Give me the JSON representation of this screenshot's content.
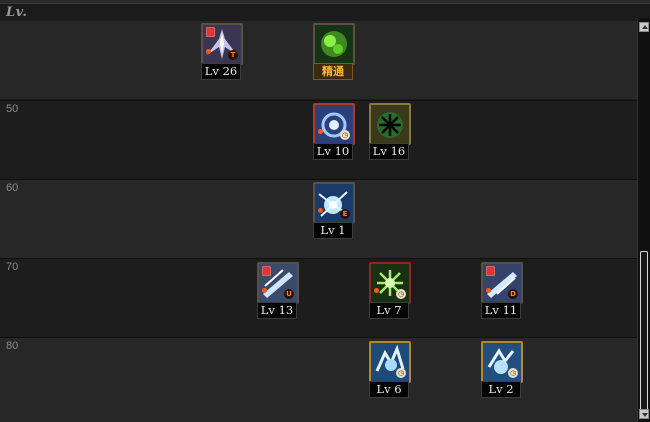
{
  "header": {
    "lv_label": "Lv."
  },
  "rows": [
    {
      "label": ""
    },
    {
      "label": "50"
    },
    {
      "label": "60"
    },
    {
      "label": "70"
    },
    {
      "label": "80"
    }
  ],
  "skills": [
    {
      "id": "s1",
      "level_text": "Lv 26",
      "icon": "winged-blade-icon",
      "locked": true,
      "badge": "T"
    },
    {
      "id": "s2",
      "level_text": "精通",
      "icon": "green-mastery-icon",
      "locked": false,
      "badge": ""
    },
    {
      "id": "s3",
      "level_text": "Lv 10",
      "icon": "blue-orb-icon",
      "locked": false,
      "badge": "clock"
    },
    {
      "id": "s4",
      "level_text": "Lv 16",
      "icon": "frost-snowflake-icon",
      "locked": false,
      "badge": ""
    },
    {
      "id": "s5",
      "level_text": "Lv 1",
      "icon": "lightning-burst-icon",
      "locked": false,
      "badge": "E"
    },
    {
      "id": "s6",
      "level_text": "Lv 13",
      "icon": "ice-slash-icon",
      "locked": true,
      "badge": "U"
    },
    {
      "id": "s7",
      "level_text": "Lv 7",
      "icon": "green-burst-icon",
      "locked": false,
      "badge": "clock"
    },
    {
      "id": "s8",
      "level_text": "Lv 11",
      "icon": "ice-slash-icon",
      "locked": true,
      "badge": "D"
    },
    {
      "id": "s9",
      "level_text": "Lv 6",
      "icon": "ice-storm-icon",
      "locked": false,
      "badge": "clock"
    },
    {
      "id": "s10",
      "level_text": "Lv 2",
      "icon": "ice-storm-icon",
      "locked": false,
      "badge": "clock"
    }
  ],
  "colors": {
    "band_light": "#272727",
    "band_dark": "#1d1d1d",
    "level_box_bg": "#050505",
    "mastery_text": "#ffb52a"
  }
}
